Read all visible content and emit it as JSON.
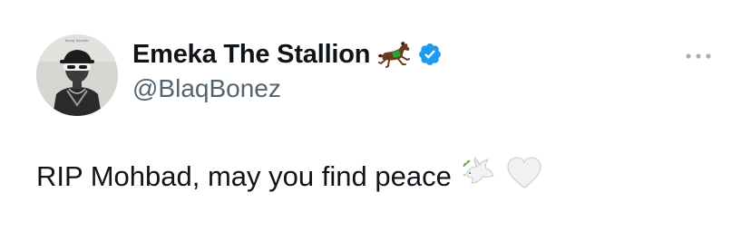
{
  "author": {
    "display_name": "Emeka The Stallion",
    "handle": "@BlaqBonez",
    "verified": true,
    "verified_color": "#1d9bf0",
    "name_emoji": "horse-icon",
    "avatar": "profile-photo"
  },
  "tweet": {
    "text": "RIP Mohbad, may you find peace",
    "emojis": [
      "dove-icon",
      "white-heart-icon"
    ]
  },
  "actions": {
    "more_icon": "more-icon"
  },
  "colors": {
    "text": "#0f1419",
    "secondary_text": "#536471",
    "background": "#ffffff"
  }
}
